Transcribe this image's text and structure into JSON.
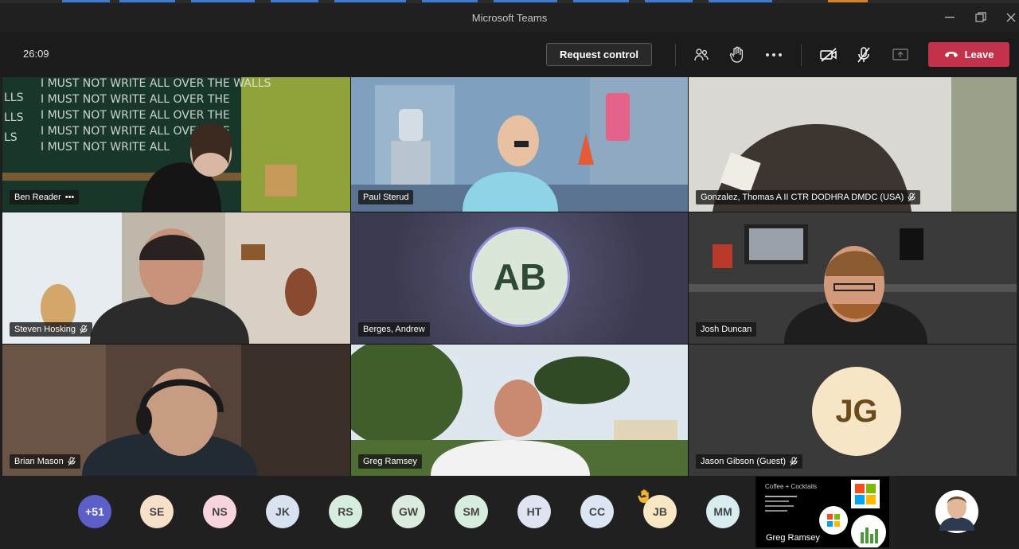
{
  "window": {
    "title": "Microsoft Teams"
  },
  "toolbar": {
    "timer": "26:09",
    "request_control_label": "Request control",
    "leave_label": "Leave"
  },
  "tiles": [
    {
      "name": "Ben Reader",
      "extra": "•••",
      "muted": false
    },
    {
      "name": "Paul Sterud",
      "muted": false
    },
    {
      "name": "Gonzalez, Thomas A II CTR DODHRA DMDC (USA)",
      "muted": true
    },
    {
      "name": "Steven Hosking",
      "muted": true
    },
    {
      "name": "Berges, Andrew",
      "initials": "AB",
      "muted": false
    },
    {
      "name": "Josh Duncan",
      "muted": false
    },
    {
      "name": "Brian Mason",
      "muted": true
    },
    {
      "name": "Greg Ramsey",
      "muted": false
    },
    {
      "name": "Jason Gibson (Guest)",
      "initials": "JG",
      "muted": true
    }
  ],
  "participants": {
    "overflow": "+51",
    "items": [
      {
        "initials": "SE",
        "color": "#f7e0c8"
      },
      {
        "initials": "NS",
        "color": "#f6d6dc"
      },
      {
        "initials": "JK",
        "color": "#d9e2f1"
      },
      {
        "initials": "RS",
        "color": "#d6ecdc"
      },
      {
        "initials": "GW",
        "color": "#dcecdc"
      },
      {
        "initials": "SM",
        "color": "#d8eedd"
      },
      {
        "initials": "HT",
        "color": "#dfe3f2"
      },
      {
        "initials": "CC",
        "color": "#dce5f3"
      },
      {
        "initials": "JB",
        "color": "#f9e6c3",
        "hand_raised": true
      },
      {
        "initials": "MM",
        "color": "#d8edf0"
      }
    ]
  },
  "share": {
    "presenter": "Greg Ramsey",
    "slide_title": "Coffee + Cocktails"
  },
  "colors": {
    "accent": "#5b5fc7",
    "leave": "#c4314b"
  }
}
